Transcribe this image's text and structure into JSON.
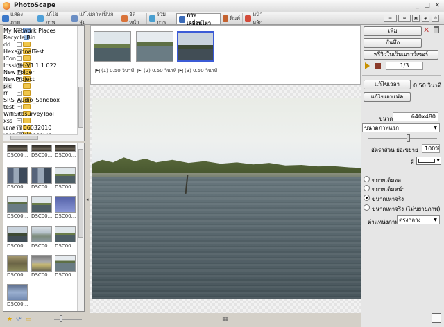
{
  "app": {
    "title": "PhotoScape"
  },
  "tabs": [
    {
      "label": "แสดงภาพ",
      "color": "#3b78c9"
    },
    {
      "label": "แก้ไขภาพ",
      "color": "#4fa0d8"
    },
    {
      "label": "แก้ไขภาพเป็นกลุ่ม",
      "color": "#6b8ec4"
    },
    {
      "label": "จัดหน้า",
      "color": "#d9733a"
    },
    {
      "label": "รวมภาพ",
      "color": "#4a9fd0"
    },
    {
      "label": "ภาพเคลื่อนไหว",
      "color": "#3b6bb8"
    },
    {
      "label": "พิมพ์",
      "color": "#c4622f"
    },
    {
      "label": "หน้าหลัก",
      "color": "#d34b3a"
    }
  ],
  "tree": {
    "items": [
      {
        "label": "My Network Places",
        "type": "net",
        "expandable": true
      },
      {
        "label": "Recycle Bin",
        "type": "bin",
        "expandable": false
      },
      {
        "label": "dd",
        "type": "folder",
        "expandable": true
      },
      {
        "label": "HexagonalTest",
        "type": "folder",
        "expandable": true
      },
      {
        "label": "ICon",
        "type": "folder",
        "expandable": true
      },
      {
        "label": "Inssider-V1.1.1.022",
        "type": "folder",
        "expandable": true
      },
      {
        "label": "New Folder",
        "type": "folder",
        "expandable": true
      },
      {
        "label": "NewProject",
        "type": "folder",
        "expandable": true
      },
      {
        "label": "pic",
        "type": "folder",
        "expandable": false
      },
      {
        "label": "rr",
        "type": "folder",
        "expandable": true
      },
      {
        "label": "SRS_Audio_Sandbox",
        "type": "folder",
        "expandable": true
      },
      {
        "label": "test",
        "type": "folder",
        "expandable": true
      },
      {
        "label": "WifiSitesurveyTool",
        "type": "folder",
        "expandable": true
      },
      {
        "label": "xss",
        "type": "folder",
        "expandable": true
      },
      {
        "label": "เอกสาร 06032010",
        "type": "folder",
        "expandable": true
      },
      {
        "label": "เอกสารโปรเจคจบเอ",
        "type": "folder",
        "expandable": true
      }
    ]
  },
  "thumbnails": {
    "caption": "DSC00...",
    "items": [
      "dark",
      "dark",
      "dark",
      "people",
      "people",
      "lake1",
      "lake2",
      "lake1",
      "blue",
      "lake3",
      "lake2",
      "lake1",
      "grassy",
      "boat",
      "lake1",
      "rocky"
    ]
  },
  "frames": [
    {
      "caption": "(1) 0.50 วินาที",
      "style": "lake1",
      "selected": false
    },
    {
      "caption": "(2) 0.50 วินาที",
      "style": "lake2",
      "selected": false
    },
    {
      "caption": "(3) 0.50 วินาที",
      "style": "lake3",
      "selected": true
    }
  ],
  "right": {
    "add_button": "เพิ่ม",
    "save_button": "บันทึก",
    "preview_browser_button": "พรีวิวในเว็บเบราว์เซอร์",
    "counter": "1/3",
    "edit_time_button": "แก้ไขเวลา",
    "time_value": "0.50 วินาที",
    "edit_effect_button": "แก้ไขเอฟเฟค",
    "size_label": "ขนาด",
    "size_value": "640x480",
    "size_select": "ขนาดภาพแรก",
    "ratio_label": "อัตราส่วน ย่อ/ขยาย",
    "ratio_value": "100%",
    "color_label": "สี",
    "radio_options": [
      {
        "label": "ขยายเต็มจอ",
        "checked": false
      },
      {
        "label": "ขยายเต็มหน้า",
        "checked": false
      },
      {
        "label": "ขนาดเท่าจริง",
        "checked": true
      },
      {
        "label": "ขนาดเท่าจริง (ไม่ขยายภาพ)",
        "checked": false
      }
    ],
    "position_label": "ตำแหน่งภาพ",
    "position_select": "ตรงกลาง"
  }
}
